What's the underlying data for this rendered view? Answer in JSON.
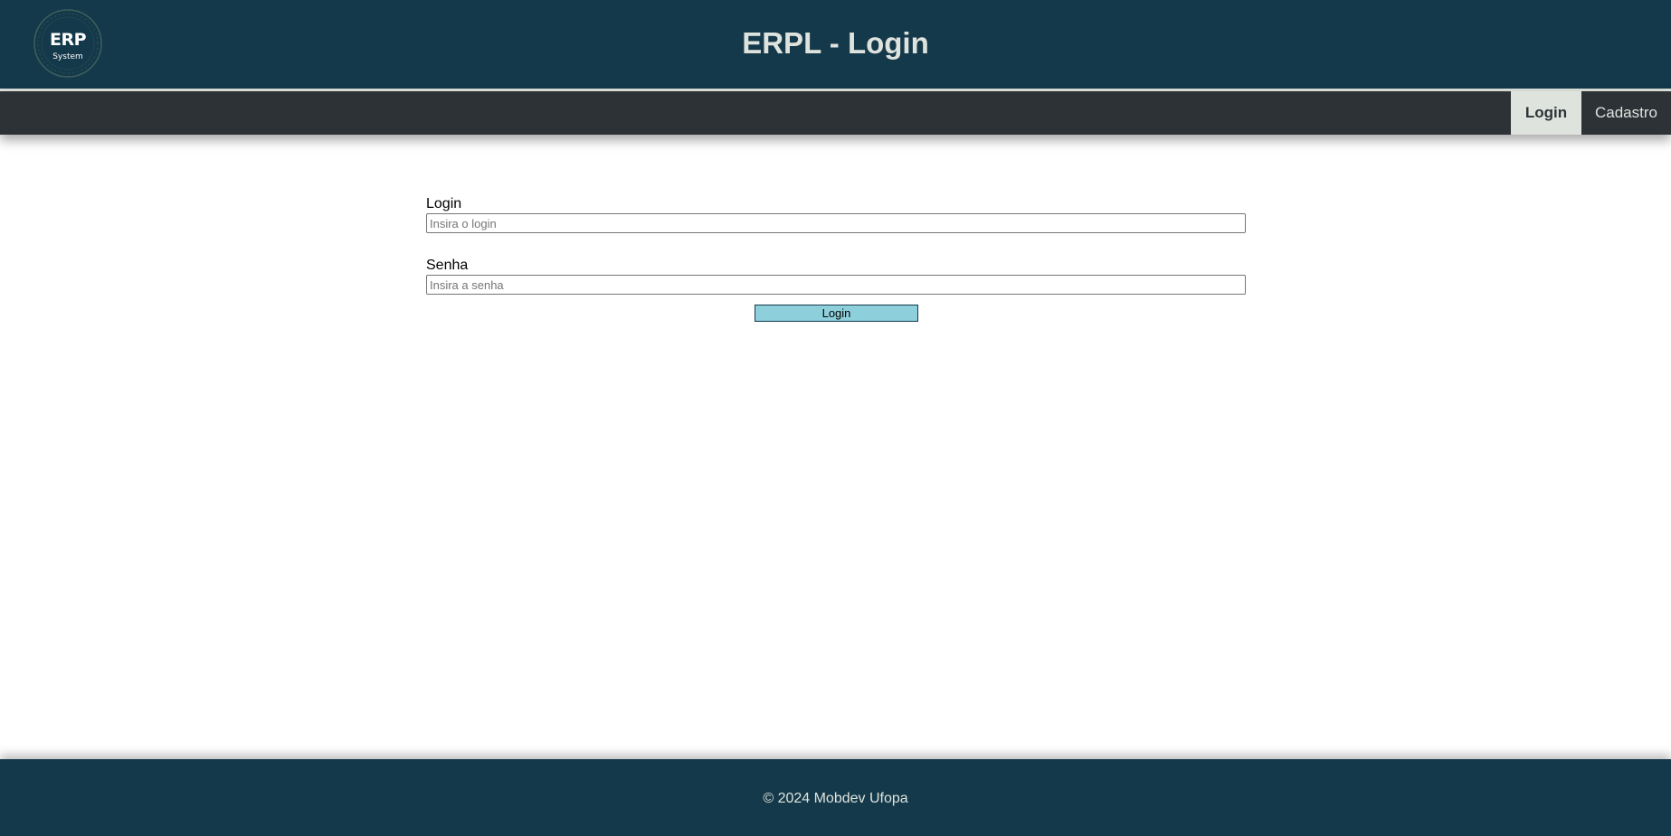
{
  "header": {
    "logo_main": "ERP",
    "logo_sub": "System",
    "title": "ERPL - Login"
  },
  "nav": {
    "items": [
      {
        "label": "Login",
        "active": true
      },
      {
        "label": "Cadastro",
        "active": false
      }
    ]
  },
  "form": {
    "login": {
      "label": "Login",
      "value": "",
      "placeholder": "Insira o login"
    },
    "password": {
      "label": "Senha",
      "value": "",
      "placeholder": "Insira a senha"
    },
    "submit_label": "Login"
  },
  "footer": {
    "text": "© 2024 Mobdev Ufopa"
  },
  "colors": {
    "header_bg": "#14394a",
    "nav_bg": "#2c3236",
    "nav_active_bg": "#dfe3de",
    "button_bg": "#8dd0dc",
    "text_light": "#dfe3de"
  },
  "icons": {
    "logo": "erp-system-logo-icon"
  }
}
